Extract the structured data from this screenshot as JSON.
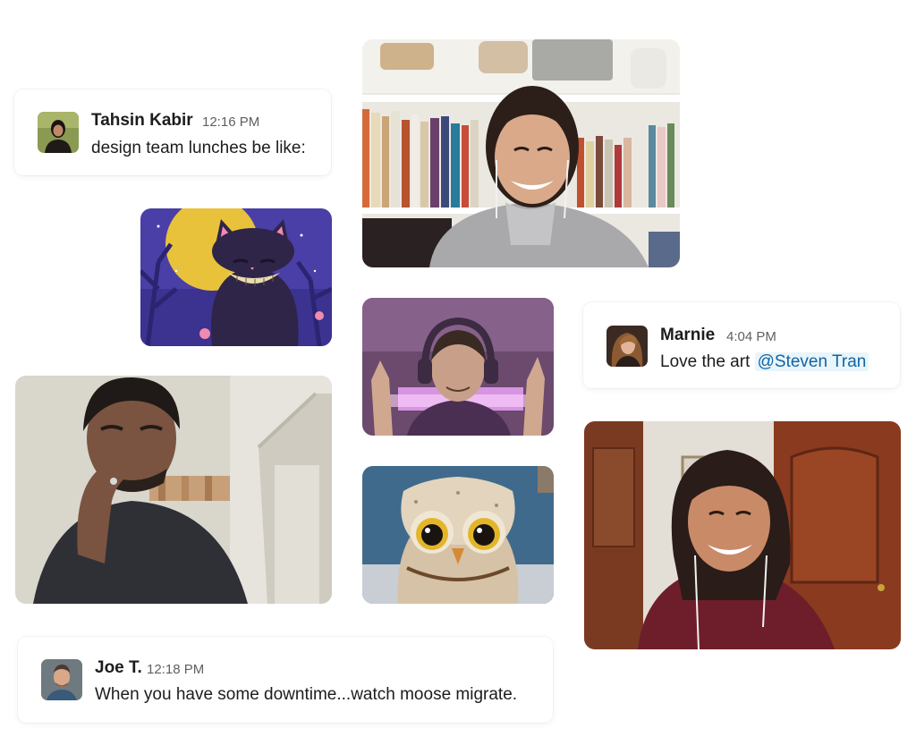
{
  "messages": {
    "tahsin": {
      "name": "Tahsin Kabir",
      "time": "12:16 PM",
      "text": "design team lunches be like:"
    },
    "marnie": {
      "name": "Marnie",
      "time": "4:04 PM",
      "text": "Love the art ",
      "mention": "@Steven Tran"
    },
    "joe": {
      "name": "Joe T.",
      "time": "12:18 PM",
      "text": "When you have some downtime...watch moose migrate."
    }
  },
  "colors": {
    "mention_bg": "#e8f5fa",
    "mention_text": "#1264a3",
    "timestamp": "#616061"
  },
  "tiles": [
    {
      "name": "video-tile-woman-bookshelf"
    },
    {
      "name": "video-tile-cat-filter"
    },
    {
      "name": "video-tile-man-headphones"
    },
    {
      "name": "video-tile-man-thinking"
    },
    {
      "name": "video-tile-owl-filter"
    },
    {
      "name": "video-tile-woman-smiling"
    }
  ]
}
